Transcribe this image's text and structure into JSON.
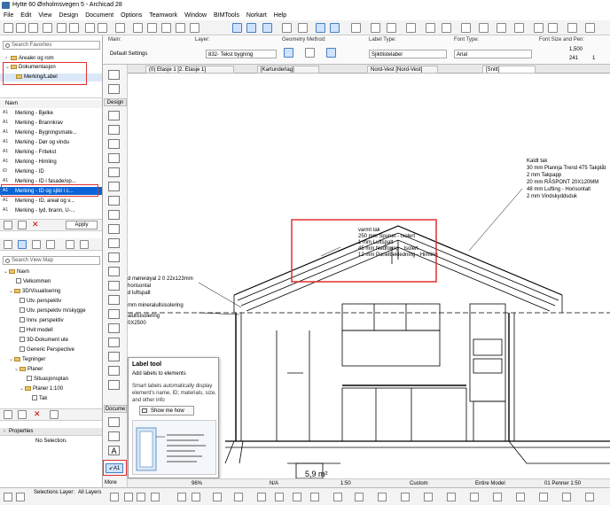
{
  "window": {
    "title": "Hytte 60 Ønholmsvegen 5 - Archicad 28"
  },
  "menu": [
    "File",
    "Edit",
    "View",
    "Design",
    "Document",
    "Options",
    "Teamwork",
    "Window",
    "BIMTools",
    "Norkart",
    "Help"
  ],
  "infobox": {
    "main_label": "Main:",
    "main_value": "Default Settings",
    "layer_label": "Layer:",
    "layer_value": "832- Tekst bygning",
    "geometry_label": "Geometry Method:",
    "labeltype_label": "Label Type:",
    "labeltype_value": "Sjiktlistelabel",
    "fonttype_label": "Font Type:",
    "fonttype_value": "Arial",
    "fontsize_label": "Font Size and Pen:",
    "fontsize_value": "1,500",
    "pen_value": "241",
    "pen_extra": "1"
  },
  "navigator": {
    "search_placeholder": "Search Favorites",
    "tree": [
      {
        "label": "Arealer og rom"
      },
      {
        "label": "Dokumentasjon"
      },
      {
        "label": "Merking/Label"
      }
    ],
    "list_header": "Navn",
    "items": [
      {
        "abbr": "A1",
        "label": "Merking - Bjelke"
      },
      {
        "abbr": "A1",
        "label": "Merking - Brannkrav"
      },
      {
        "abbr": "A1",
        "label": "Merking - Bygningsmate..."
      },
      {
        "abbr": "A1",
        "label": "Merking - Dør og vindu"
      },
      {
        "abbr": "A1",
        "label": "Merking - Fritekst"
      },
      {
        "abbr": "A1",
        "label": "Merking - Himling"
      },
      {
        "abbr": "ID",
        "label": "Merking - ID"
      },
      {
        "abbr": "A1",
        "label": "Merking - ID i fasade/op..."
      },
      {
        "abbr": "A1",
        "label": "Merking - ID og sjikt i c..."
      },
      {
        "abbr": "A1",
        "label": "Merking - ID, areal og v..."
      },
      {
        "abbr": "A1",
        "label": "Merking - lyd, brann, U-..."
      }
    ],
    "apply_label": "Apply",
    "viewmap_placeholder": "Search View Map",
    "viewmap": [
      {
        "label": "Navn"
      },
      {
        "label": "Velkommen"
      },
      {
        "label": "3D/Visualisering"
      },
      {
        "label": "Utv. perspektiv"
      },
      {
        "label": "Utv. perspektiv m/skygge"
      },
      {
        "label": "Innv. perspektiv"
      },
      {
        "label": "Hvit modell"
      },
      {
        "label": "3D-Dokument ute"
      },
      {
        "label": "Generic Perspective"
      },
      {
        "label": "Tegninger"
      },
      {
        "label": "Planer"
      },
      {
        "label": "Situasjonsplan"
      },
      {
        "label": "Planer 1:100"
      },
      {
        "label": "Tak"
      }
    ],
    "properties_label": "Properties",
    "no_selection": "No Selection."
  },
  "toolbox": {
    "design_label": "Design",
    "document_label": "Docume",
    "more_label": "More"
  },
  "tabs": [
    "(0) Etasje 1 [2. Etasje 1]",
    "[Kartunderlag]",
    "Nord-Vest [Nord-Vest]",
    "[Snitt]"
  ],
  "tooltip": {
    "title": "Label tool",
    "subtitle": "Add labels to elements",
    "body": "Smart labels automatically display element's name, ID; materials, size, and other info",
    "button": "Show me how"
  },
  "drawing": {
    "roof_ext": [
      "Kaldt tak",
      "30 mm  Plannja Trend 475 Takplåt",
      "2 mm  Takpapp",
      "20 mm  RÅSPONT 20X120MM",
      "48 mm  Lufting - Horisontalt",
      "2 mm  Vindskyddsduk"
    ],
    "roof_int": [
      "varmt tak",
      "250 mm  Spunet - Isolert",
      "1 mm  Luftspalt",
      "45 mm  Nedforing - Isolert",
      "12 mm  Panelbekledning - Himling"
    ],
    "left_notes": [
      "d mørerøyal 2 0 22x123mm",
      "horisontal",
      "d luftspalt",
      "mm mineralullsisolering",
      "alullsisolering",
      "0X2500"
    ],
    "area": "5,9 m²"
  },
  "statusbar": {
    "zoom": "96%",
    "na": "N/A",
    "scale": "1:50",
    "custom": "Custom",
    "model": "Entire Model",
    "penset": "01 Penner 1:50"
  },
  "bottombar": {
    "selection_layer": "Selections Layer:",
    "all_layers": "All Layers"
  }
}
